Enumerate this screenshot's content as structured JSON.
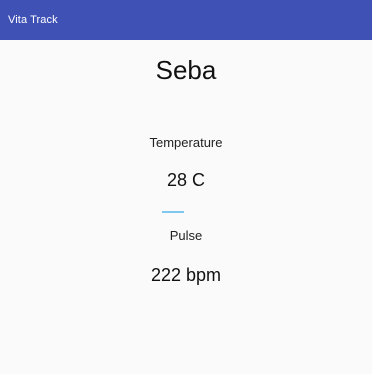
{
  "app_bar": {
    "title": "Vita Track",
    "color": "#3f51b5"
  },
  "patient": {
    "name": "Seba"
  },
  "vitals": {
    "temperature": {
      "label": "Temperature",
      "value": "28 C"
    },
    "pulse": {
      "label": "Pulse",
      "value": "222 bpm"
    }
  },
  "colors": {
    "accent": "#7fc8ef",
    "background": "#fafafa"
  }
}
